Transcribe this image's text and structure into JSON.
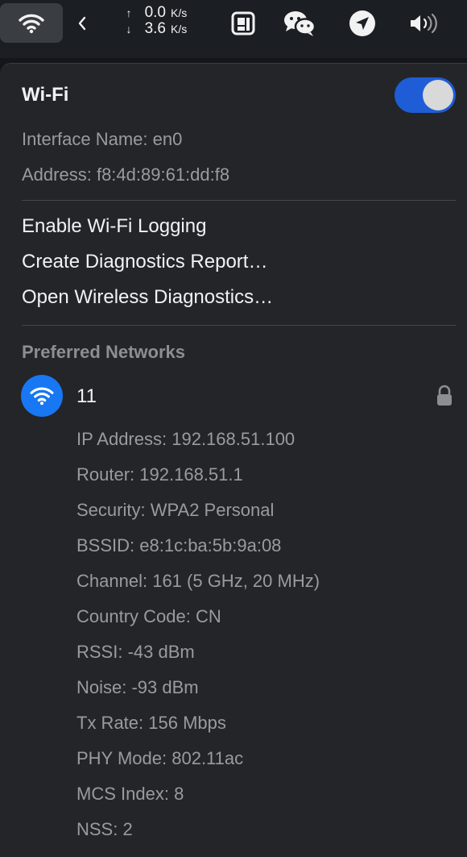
{
  "menubar": {
    "upload_arrow": "↑",
    "upload_speed": "0.0",
    "upload_unit": "K/s",
    "download_arrow": "↓",
    "download_speed": "3.6",
    "download_unit": "K/s",
    "icons": [
      "wifi-icon",
      "chevron-left-icon",
      "sim-card-icon",
      "wechat-icon",
      "location-arrow-icon",
      "volume-icon"
    ]
  },
  "wifi": {
    "title": "Wi-Fi",
    "enabled": true,
    "accent_color": "#1f5dd6",
    "interface_label": "Interface Name:",
    "interface_value": "en0",
    "address_label": "Address:",
    "address_value": "f8:4d:89:61:dd:f8"
  },
  "menu": [
    {
      "label": "Enable Wi-Fi Logging"
    },
    {
      "label": "Create Diagnostics Report…"
    },
    {
      "label": "Open Wireless Diagnostics…"
    }
  ],
  "preferred": {
    "header": "Preferred Networks",
    "network": {
      "name": "11",
      "icon_color": "#1877f2",
      "locked": true,
      "details": [
        {
          "label": "IP Address:",
          "value": "192.168.51.100"
        },
        {
          "label": "Router:",
          "value": "192.168.51.1"
        },
        {
          "label": "Security:",
          "value": "WPA2 Personal"
        },
        {
          "label": "BSSID:",
          "value": "e8:1c:ba:5b:9a:08"
        },
        {
          "label": "Channel:",
          "value": "161 (5 GHz, 20 MHz)"
        },
        {
          "label": "Country Code:",
          "value": "CN"
        },
        {
          "label": "RSSI:",
          "value": "-43 dBm"
        },
        {
          "label": "Noise:",
          "value": "-93 dBm"
        },
        {
          "label": "Tx Rate:",
          "value": "156 Mbps"
        },
        {
          "label": "PHY Mode:",
          "value": "802.11ac"
        },
        {
          "label": "MCS Index:",
          "value": "8"
        },
        {
          "label": "NSS:",
          "value": "2"
        }
      ]
    }
  }
}
